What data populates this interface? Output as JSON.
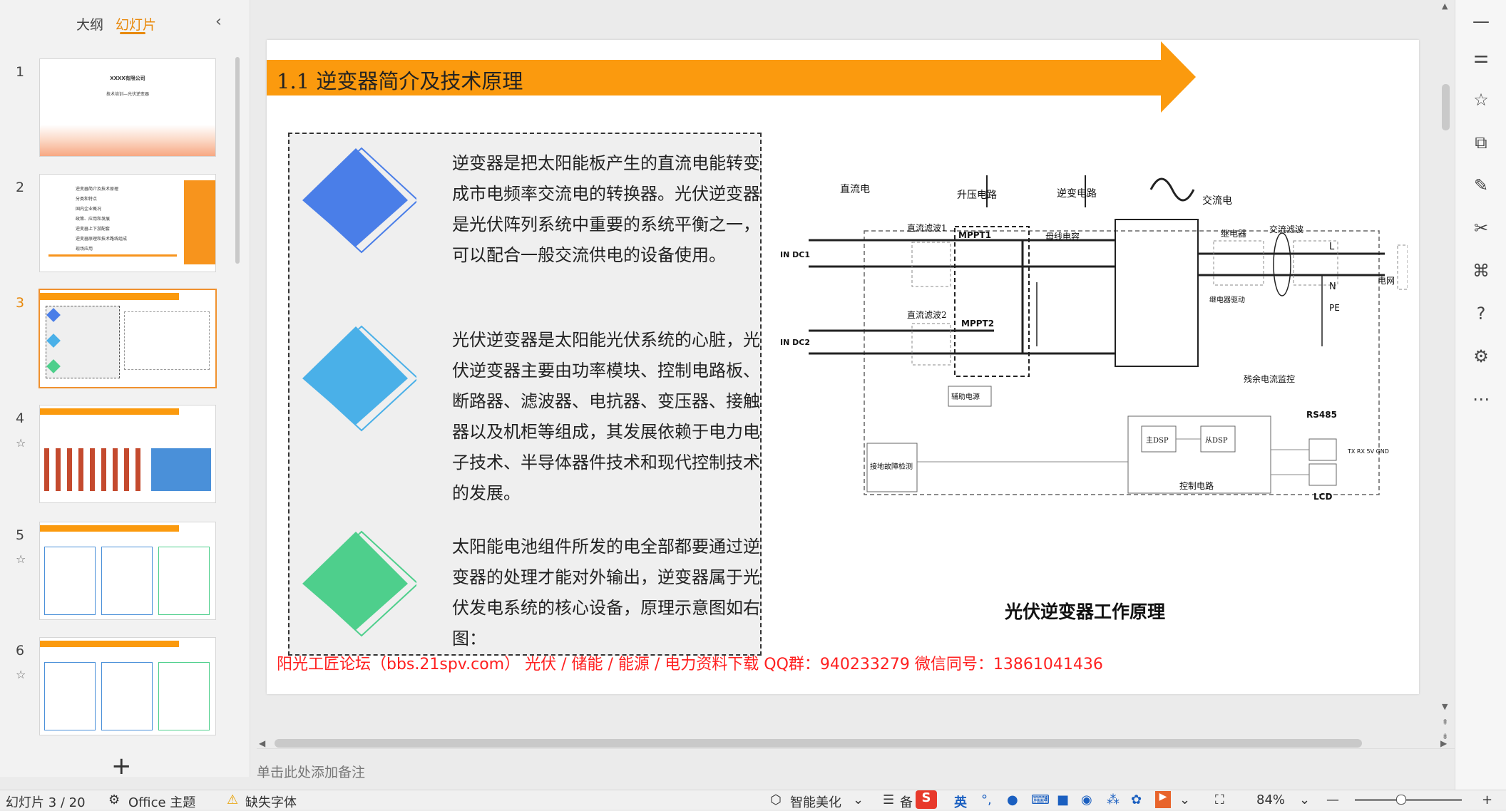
{
  "left_panel": {
    "tab_outline": "大纲",
    "tab_slides": "幻灯片",
    "collapse_icon": "chevron-left-icon",
    "slides": [
      {
        "num": "1",
        "title": "XXXX有限公司",
        "subtitle": "技术培训—光伏逆变器"
      },
      {
        "num": "2",
        "items": [
          "逆变器简介及技术原理",
          "分类和特点",
          "国内企业概况",
          "政策、应用和发展",
          "逆变器上下游配套",
          "逆变器原理和技术路线组成",
          "现场应用"
        ]
      },
      {
        "num": "3"
      },
      {
        "num": "4"
      },
      {
        "num": "5"
      },
      {
        "num": "6"
      }
    ],
    "add_slide": "+"
  },
  "slide": {
    "title": "1.1  逆变器简介及技术原理",
    "accent_color": "#fb9a0e",
    "paragraphs": [
      "逆变器是把太阳能板产生的直流电能转变成市电频率交流电的转换器。光伏逆变器是光伏阵列系统中重要的系统平衡之一，可以配合一般交流供电的设备使用。",
      "光伏逆变器是太阳能光伏系统的心脏，光伏逆变器主要由功率模块、控制电路板、断路器、滤波器、电抗器、变压器、接触器以及机柜等组成，其发展依赖于电力电子技术、半导体器件技术和现代控制技术的发展。",
      "太阳能电池组件所发的电全部都要通过逆变器的处理才能对外输出，逆变器属于光伏发电系统的核心设备，原理示意图如右图："
    ],
    "diamond_colors": [
      "#4a7ee8",
      "#4ab0e8",
      "#4ecf8c"
    ],
    "footer": "阳光工匠论坛（bbs.21spv.com）  光伏 / 储能 / 能源 / 电力资料下载  QQ群：940233279    微信同号：13861041436",
    "diagram": {
      "caption": "光伏逆变器工作原理",
      "labels": {
        "dc": "直流电",
        "boost": "升压电路",
        "inverter": "逆变电路",
        "ac": "交流电",
        "dc_filter1": "直流滤波1",
        "dc_filter2": "直流滤波2",
        "mppt1": "MPPT1",
        "mppt2": "MPPT2",
        "bus_cap": "母线电容",
        "relay": "继电器",
        "ac_filter": "交流滤波",
        "grid": "电网",
        "relay_drive": "继电器驱动",
        "aux_power": "辅助电源",
        "residual": "残余电流监控",
        "ground_fault": "接地故障检测",
        "main_dsp": "主DSP",
        "slave_dsp": "从DSP",
        "control": "控制电路",
        "rs485": "RS485",
        "lcd": "LCD",
        "in_dc1": "IN DC1",
        "in_dc2": "IN DC2",
        "L": "L",
        "N": "N",
        "PE": "PE",
        "rs_pins": "TX RX 5V GND"
      }
    }
  },
  "notes_placeholder": "单击此处添加备注",
  "status_bar": {
    "slide_indicator": "幻灯片 3 / 20",
    "theme": "Office 主题",
    "missing_font": "缺失字体",
    "smart_beautify": "智能美化",
    "notes_short": "备",
    "ime": "英",
    "zoom": "84%"
  },
  "right_sidebar_icons": [
    "minimize-icon",
    "adjust-icon",
    "star-icon",
    "copy-icon",
    "design-icon",
    "tools-icon",
    "book-icon",
    "help-icon",
    "settings-icon",
    "more-icon"
  ]
}
